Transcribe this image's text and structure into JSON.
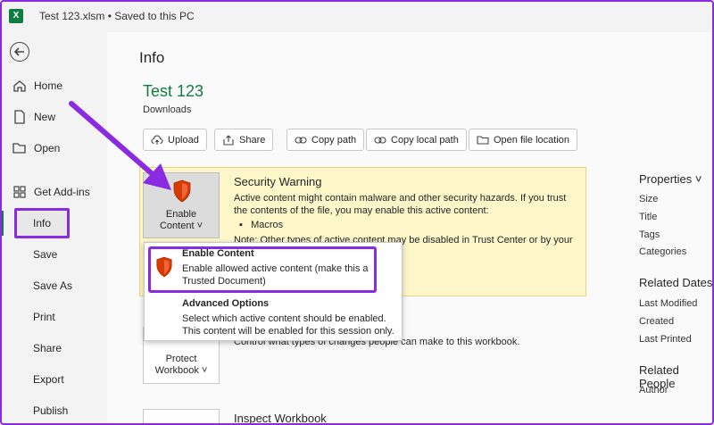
{
  "window": {
    "title": "Test 123.xlsm • Saved to this PC",
    "app_icon": "excel-icon"
  },
  "sidebar": {
    "back_icon": "back-arrow-icon",
    "items": [
      {
        "label": "Home",
        "icon": "home-icon"
      },
      {
        "label": "New",
        "icon": "new-document-icon"
      },
      {
        "label": "Open",
        "icon": "folder-open-icon"
      },
      {
        "label": "Get Add-ins",
        "icon": "add-ins-grid-icon"
      },
      {
        "label": "Info",
        "selected": true
      },
      {
        "label": "Save"
      },
      {
        "label": "Save As"
      },
      {
        "label": "Print"
      },
      {
        "label": "Share"
      },
      {
        "label": "Export"
      },
      {
        "label": "Publish"
      }
    ]
  },
  "main": {
    "page_title": "Info",
    "document": {
      "name": "Test 123",
      "location": "Downloads"
    },
    "toolbar": [
      {
        "label": "Upload",
        "icon": "cloud-upload-icon"
      },
      {
        "label": "Share",
        "icon": "share-icon"
      },
      {
        "label": "Copy path",
        "icon": "link-icon"
      },
      {
        "label": "Copy local path",
        "icon": "link-icon"
      },
      {
        "label": "Open file location",
        "icon": "folder-icon"
      }
    ],
    "security": {
      "tile_line1": "Enable",
      "tile_line2": "Content ˅",
      "title": "Security Warning",
      "body": "Active content might contain malware and other security hazards. If you trust the contents of the file, you may enable this active content:",
      "bullet": "Macros",
      "note": "Note: Other types of active content may be disabled in Trust Center or by your"
    },
    "protect": {
      "tile_line1": "Protect",
      "tile_line2": "Workbook ˅",
      "desc": "Control what types of changes people can make to this workbook."
    },
    "inspect": {
      "title": "Inspect Workbook"
    },
    "dropdown": {
      "option1_title": "Enable Content",
      "option1_desc": "Enable allowed active content (make this a Trusted Document)",
      "option2_title": "Advanced Options",
      "option2_desc": "Select which active content should be enabled. This content will be enabled for this session only."
    }
  },
  "properties": {
    "title": "Properties ˅",
    "items": [
      "Size",
      "Title",
      "Tags",
      "Categories"
    ],
    "related_dates": {
      "title": "Related Dates",
      "items": [
        "Last Modified",
        "Created",
        "Last Printed"
      ]
    },
    "related_people": {
      "title": "Related People",
      "items": [
        "Author"
      ]
    }
  },
  "colors": {
    "accent": "#107c41",
    "highlight": "#8a2be2",
    "warning_bg": "#fdf6c9",
    "shield": "#d83b01"
  }
}
